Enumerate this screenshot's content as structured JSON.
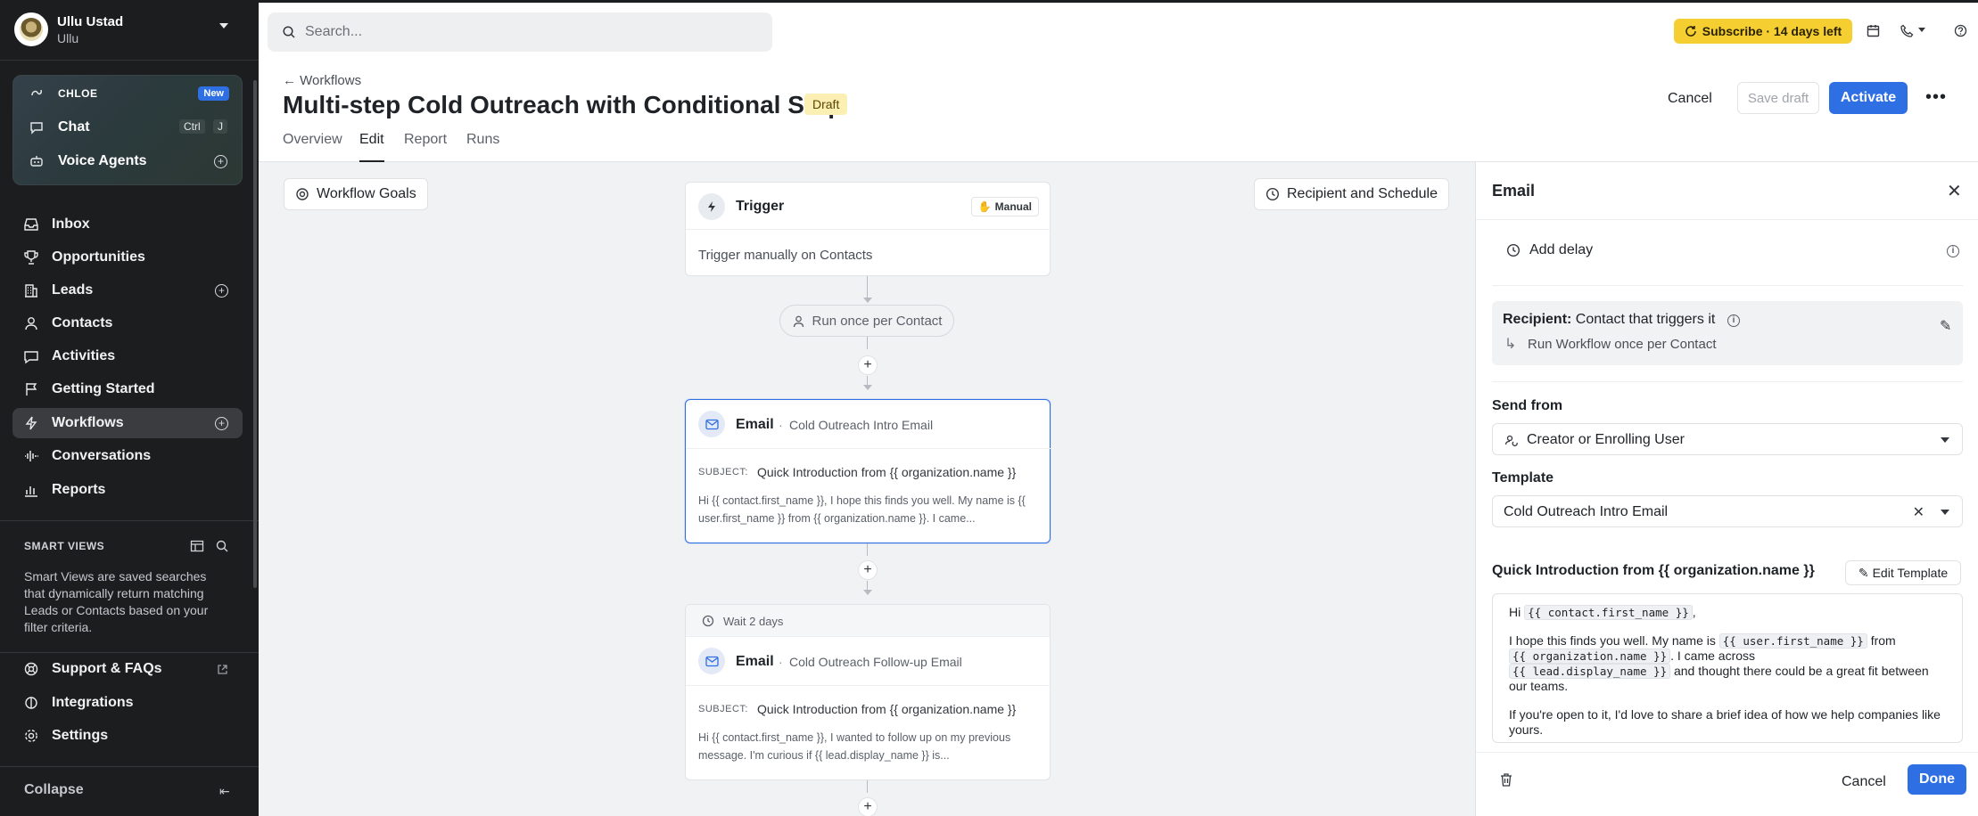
{
  "sidebar": {
    "org_name": "Ullu Ustad",
    "org_sub": "Ullu",
    "ai": {
      "chloe_label": "CHLOE",
      "chloe_badge": "New",
      "chat_label": "Chat",
      "chat_kbd1": "Ctrl",
      "chat_kbd2": "J",
      "voice_label": "Voice Agents"
    },
    "nav": [
      {
        "label": "Inbox",
        "icon": "inbox-icon"
      },
      {
        "label": "Opportunities",
        "icon": "trophy-icon"
      },
      {
        "label": "Leads",
        "icon": "building-icon"
      },
      {
        "label": "Contacts",
        "icon": "person-icon"
      },
      {
        "label": "Activities",
        "icon": "chat-bubble-icon"
      },
      {
        "label": "Getting Started",
        "icon": "flag-icon"
      },
      {
        "label": "Workflows",
        "icon": "bolt-icon"
      },
      {
        "label": "Conversations",
        "icon": "audio-wave-icon"
      },
      {
        "label": "Reports",
        "icon": "chart-icon"
      }
    ],
    "smart_views_title": "SMART VIEWS",
    "smart_views_desc": "Smart Views are saved searches that dynamically return matching Leads or Contacts based on your filter criteria.",
    "bottom_nav": [
      {
        "label": "Support & FAQs",
        "icon": "lifebuoy-icon"
      },
      {
        "label": "Integrations",
        "icon": "integration-icon"
      },
      {
        "label": "Settings",
        "icon": "gear-icon"
      }
    ],
    "collapse_label": "Collapse"
  },
  "topbar": {
    "search_placeholder": "Search...",
    "subscribe_label": "Subscribe · 14 days left"
  },
  "header": {
    "back_label": "Workflows",
    "title": "Multi-step Cold Outreach with Conditional Stop",
    "status_badge": "Draft",
    "tabs": [
      "Overview",
      "Edit",
      "Report",
      "Runs"
    ],
    "active_tab": "Edit",
    "cancel_label": "Cancel",
    "save_label": "Save draft",
    "activate_label": "Activate"
  },
  "canvas": {
    "goals_label": "Workflow Goals",
    "recipient_schedule_label": "Recipient and Schedule",
    "trigger": {
      "title": "Trigger",
      "badge": "Manual",
      "desc": "Trigger manually on Contacts"
    },
    "run_once_label": "Run once per Contact",
    "email1": {
      "title": "Email",
      "name": "Cold Outreach Intro Email",
      "subject_label": "SUBJECT:",
      "subject": "Quick Introduction from {{ organization.name }}",
      "preview": "Hi {{ contact.first_name }}, I hope this finds you well. My name is {{ user.first_name }} from {{ organization.name }}. I came..."
    },
    "wait_label": "Wait 2 days",
    "email2": {
      "title": "Email",
      "name": "Cold Outreach Follow-up Email",
      "subject_label": "SUBJECT:",
      "subject": "Quick Introduction from {{ organization.name }}",
      "preview": "Hi {{ contact.first_name }}, I wanted to follow up on my previous message. I'm curious if {{ lead.display_name }} is..."
    }
  },
  "panel": {
    "title": "Email",
    "add_delay_label": "Add delay",
    "recipient_label": "Recipient:",
    "recipient_value": "Contact that triggers it",
    "run_mode": "Run Workflow once per Contact",
    "send_from_label": "Send from",
    "send_from_value": "Creator or Enrolling User",
    "template_label": "Template",
    "template_value": "Cold Outreach Intro Email",
    "template_subject": "Quick Introduction from {{ organization.name }}",
    "edit_template_label": "Edit Template",
    "body": {
      "greeting_pre": "Hi ",
      "token_first_name": "{{ contact.first_name }}",
      "greeting_post": ",",
      "p2_a": "I hope this finds you well. My name is ",
      "token_user": "{{ user.first_name }}",
      "p2_b": " from",
      "token_org": "{{ organization.name }}",
      "p2_c": ". I came across",
      "token_lead": "{{ lead.display_name }}",
      "p2_d": " and thought there could be a great fit between our teams.",
      "p3": "If you're open to it, I'd love to share a brief idea of how we help companies like yours."
    },
    "cancel_label": "Cancel",
    "done_label": "Done"
  },
  "colors": {
    "accent": "#2f6fe4",
    "sidebar_bg": "#1c1d1f",
    "subscribe_bg": "#f5cf32",
    "draft_bg": "#fcefb4"
  }
}
